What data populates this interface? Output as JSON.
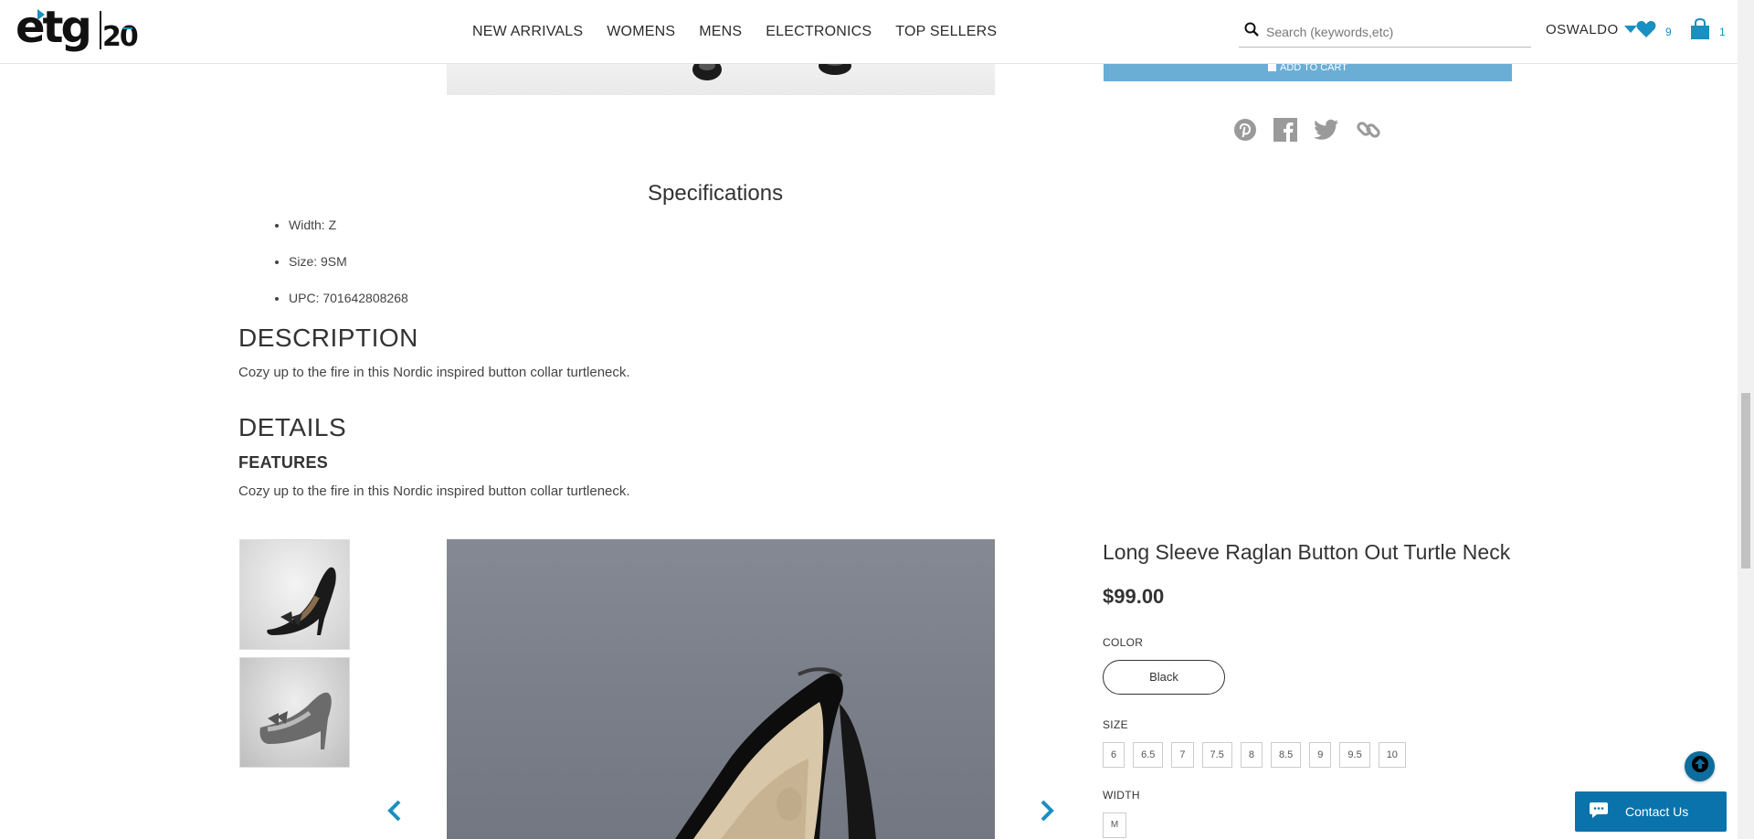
{
  "header": {
    "logo_text": "etg20",
    "nav": [
      "NEW ARRIVALS",
      "WOMENS",
      "MENS",
      "ELECTRONICS",
      "TOP SELLERS"
    ],
    "search_placeholder": "Search (keywords,etc)",
    "user_name": "OSWALDO",
    "wishlist_count": "9",
    "cart_count": "1"
  },
  "colors": {
    "accent": "#1a8fc1",
    "add_to_cart_bg": "#6aaed6",
    "contact_bg": "#0a73ab",
    "back_to_top": "#0d6d9c"
  },
  "upper_product": {
    "add_to_cart_label": "ADD TO CART",
    "social_icons": [
      "pinterest-icon",
      "facebook-icon",
      "twitter-icon",
      "link-icon"
    ]
  },
  "specifications": {
    "title": "Specifications",
    "items": [
      "Width: Z",
      "Size: 9SM",
      "UPC: 701642808268"
    ]
  },
  "description": {
    "heading": "DESCRIPTION",
    "text": "Cozy up to the fire in this Nordic inspired button collar turtleneck."
  },
  "details": {
    "heading": "DETAILS",
    "features_heading": "FEATURES",
    "features_text": "Cozy up to the fire in this Nordic inspired button collar turtleneck."
  },
  "product": {
    "title": "Long Sleeve Raglan Button Out Turtle Neck",
    "price": "$99.00",
    "color_label": "COLOR",
    "selected_color": "Black",
    "size_label": "SIZE",
    "sizes": [
      "6",
      "6.5",
      "7",
      "7.5",
      "8",
      "8.5",
      "9",
      "9.5",
      "10"
    ],
    "width_label": "WIDTH",
    "width_option": "M"
  },
  "widgets": {
    "contact_label": "Contact Us"
  }
}
